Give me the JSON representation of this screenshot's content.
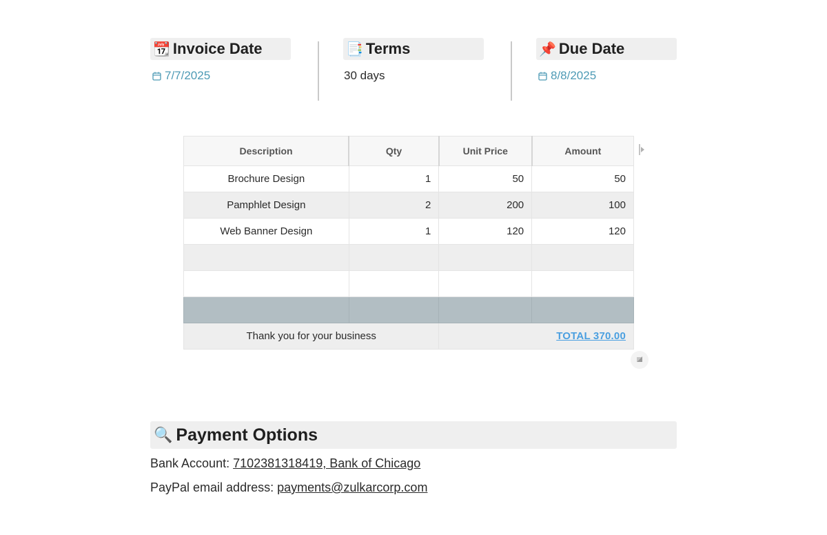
{
  "header": {
    "invoice_date": {
      "emoji": "📆",
      "label": "Invoice Date",
      "value": "7/7/2025"
    },
    "terms": {
      "emoji": "📑",
      "label": "Terms",
      "value": "30 days"
    },
    "due_date": {
      "emoji": "📌",
      "label": "Due Date",
      "value": "8/8/2025"
    }
  },
  "table": {
    "columns": [
      "Description",
      "Qty",
      "Unit Price",
      "Amount"
    ],
    "rows": [
      [
        "Brochure Design",
        "1",
        "50",
        "50"
      ],
      [
        "Pamphlet Design",
        "2",
        "200",
        "100"
      ],
      [
        "Web Banner Design",
        "1",
        "120",
        "120"
      ],
      [
        "",
        "",
        "",
        ""
      ],
      [
        "",
        "",
        "",
        ""
      ],
      [
        "",
        "",
        "",
        ""
      ]
    ],
    "footer_message": "Thank you for your business",
    "total": "TOTAL 370.00"
  },
  "payment": {
    "emoji": "🔍",
    "title": "Payment Options",
    "bank_label": "Bank Account: ",
    "bank_value": "7102381318419, Bank of Chicago",
    "paypal_label": "PayPal email address: ",
    "paypal_value": "payments@zulkarcorp.com"
  },
  "colors": {
    "date_link": "#4d9ab5",
    "total_link": "#4a9fe0",
    "accent_row": "#b2bec3"
  }
}
